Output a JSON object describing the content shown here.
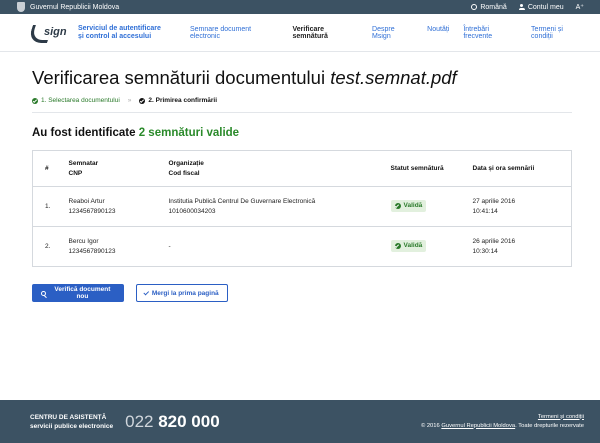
{
  "gov_bar": {
    "title": "Guvernul Republicii Moldova",
    "language": "Română",
    "account": "Contul meu",
    "font_size": "A⁺"
  },
  "header": {
    "logo_text": "sign",
    "tagline_line1": "Serviciul de autentificare",
    "tagline_line2": "și control al accesului",
    "nav": [
      {
        "label": "Semnare document electronic",
        "active": false
      },
      {
        "label": "Verificare semnătură",
        "active": true
      },
      {
        "label": "Despre Msign",
        "active": false
      },
      {
        "label": "Noutăți",
        "active": false
      },
      {
        "label": "Întrebări frecvente",
        "active": false
      },
      {
        "label": "Termeni și condiții",
        "active": false
      }
    ]
  },
  "page": {
    "title": "Verificarea semnăturii documentului",
    "filename": "test.semnat.pdf",
    "steps": [
      {
        "label": "1. Selectarea documentului",
        "state": "done"
      },
      {
        "label": "2. Primirea confirmării",
        "state": "current"
      }
    ],
    "step_separator": "»",
    "result_prefix": "Au fost identificate",
    "result_count": "2 semnături valide"
  },
  "table": {
    "headers": {
      "num": "#",
      "signer_1": "Semnatar",
      "signer_2": "CNP",
      "org_1": "Organizație",
      "org_2": "Cod fiscal",
      "status": "Statut semnătură",
      "datetime": "Data și ora semnării"
    },
    "rows": [
      {
        "num": "1.",
        "signer": "Reaboi Artur",
        "cnp": "1234567890123",
        "org": "Institutia Publică Centrul De Guvernare Electronică",
        "fiscal": "1010600034203",
        "status": "Validă",
        "date": "27 aprilie 2016",
        "time": "10:41:14"
      },
      {
        "num": "2.",
        "signer": "Bercu Igor",
        "cnp": "1234567890123",
        "org": "-",
        "fiscal": "",
        "status": "Validă",
        "date": "26 aprilie 2016",
        "time": "10:30:14"
      }
    ]
  },
  "actions": {
    "verify_new": "Verifică document nou",
    "go_home": "Mergi la prima pagină"
  },
  "footer": {
    "help_line1": "CENTRU DE ASISTENȚĂ",
    "help_line2": "servicii publice electronice",
    "phone_prefix": "022",
    "phone_number": "820 000",
    "terms": "Termeni și condiții",
    "copyright_prefix": "© 2016",
    "copyright_link": "Guvernul Republicii Moldova",
    "copyright_suffix": ". Toate drepturile rezervate"
  },
  "colors": {
    "bar_bg": "#3c5263",
    "accent": "#2f6fd6",
    "button": "#2b5fc4",
    "valid_green": "#2a7a2a"
  },
  "icons": [
    "crest-icon",
    "globe-icon",
    "user-icon",
    "check-circle-icon",
    "search-icon",
    "checkmark-icon"
  ]
}
